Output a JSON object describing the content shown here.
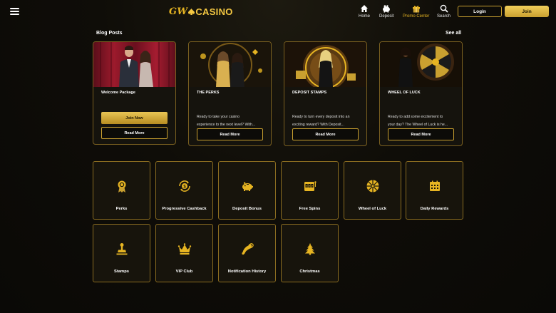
{
  "header": {
    "logo_gw": "GW",
    "logo_casino": "CASINO",
    "nav": [
      {
        "label": "Home",
        "icon": "home-icon"
      },
      {
        "label": "Deposit",
        "icon": "piggy-bank-icon"
      },
      {
        "label": "Promo Center",
        "icon": "gift-icon"
      },
      {
        "label": "Search",
        "icon": "search-icon"
      }
    ],
    "login_label": "Login",
    "join_label": "Join"
  },
  "blog": {
    "title": "Blog Posts",
    "see_all": "See all",
    "posts": [
      {
        "title": "Welcome Package",
        "desc": "",
        "join_label": "Join Now",
        "read_more": "Read More"
      },
      {
        "title": "THE PERKS",
        "desc": "Ready to take your casino\nexperience to the next level? With...",
        "read_more": "Read More"
      },
      {
        "title": "DEPOSIT STAMPS",
        "desc": "Ready to turn every deposit into an\nexciting reward? With Deposit...",
        "read_more": "Read More"
      },
      {
        "title": "WHEEL OF LUCK",
        "desc": "Ready to add some excitement to\nyour day? The Wheel of Luck is he...",
        "read_more": "Read More"
      }
    ]
  },
  "tiles": [
    {
      "label": "Perks",
      "icon": "medal-icon"
    },
    {
      "label": "Progressive Cashback",
      "icon": "cashback-icon"
    },
    {
      "label": "Deposit Bonus",
      "icon": "piggy-bank-icon"
    },
    {
      "label": "Free Spins",
      "icon": "slot-machine-icon"
    },
    {
      "label": "Wheel of Luck",
      "icon": "wheel-icon"
    },
    {
      "label": "Daily Rewards",
      "icon": "calendar-icon"
    },
    {
      "label": "Stamps",
      "icon": "stamp-icon"
    },
    {
      "label": "VIP Club",
      "icon": "crown-icon"
    },
    {
      "label": "Notification History",
      "icon": "horn-icon"
    },
    {
      "label": "Christmas",
      "icon": "christmas-tree-icon"
    }
  ],
  "colors": {
    "gold": "#e6b422",
    "gold_dark": "#c9a030",
    "background": "#0f0d08",
    "card": "#15130d"
  }
}
